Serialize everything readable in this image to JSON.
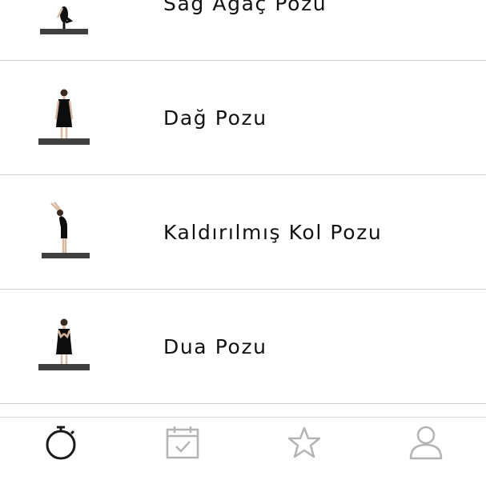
{
  "pose_list": {
    "items": [
      {
        "label": "Sağ Ağaç Pozu",
        "icon": "tree-pose-figure"
      },
      {
        "label": "Dağ Pozu",
        "icon": "mountain-pose-figure"
      },
      {
        "label": "Kaldırılmış Kol Pozu",
        "icon": "raised-arms-pose-figure"
      },
      {
        "label": "Dua Pozu",
        "icon": "prayer-pose-figure"
      }
    ]
  },
  "tab_bar": {
    "tabs": [
      {
        "icon": "stopwatch-icon",
        "active": true
      },
      {
        "icon": "calendar-check-icon",
        "active": false
      },
      {
        "icon": "star-icon",
        "active": false
      },
      {
        "icon": "person-icon",
        "active": false
      }
    ],
    "active_color": "#1a1a1a",
    "inactive_color": "#b4b4b4"
  }
}
